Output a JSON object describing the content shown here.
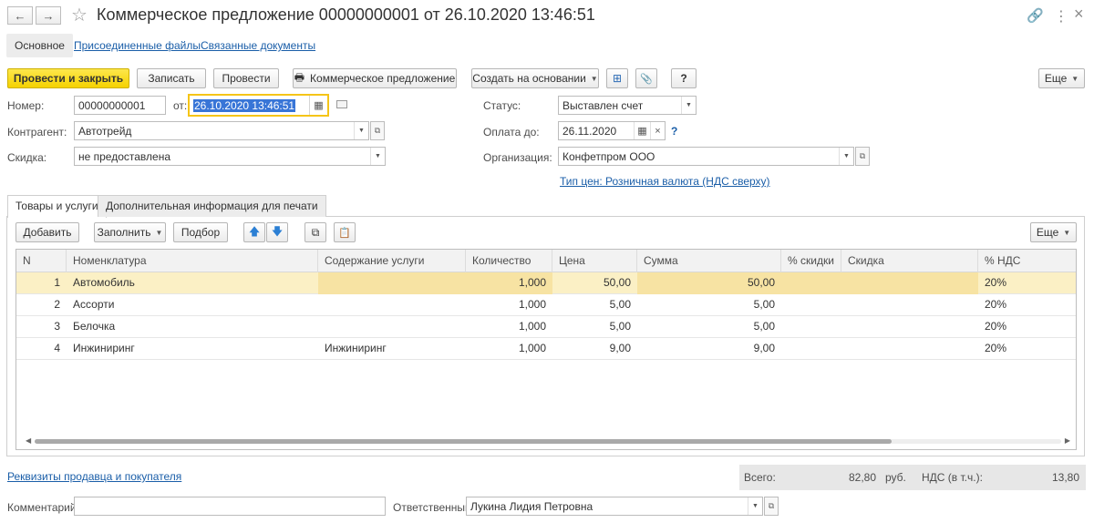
{
  "window": {
    "title": "Коммерческое предложение 00000000001 от 26.10.2020 13:46:51",
    "back_icon": "←",
    "forward_icon": "→",
    "star_icon": "☆",
    "link_icon": "🔗",
    "menu_icon": "⋮",
    "close_icon": "×"
  },
  "top_tabs": {
    "main": "Основное",
    "files": "Присоединенные файлы",
    "docs": "Связанные документы"
  },
  "toolbar": {
    "post_close": "Провести и закрыть",
    "save": "Записать",
    "post": "Провести",
    "print_icon": "🖶",
    "offer": "Коммерческое предложение",
    "create_based": "Создать на основании",
    "structure_icon": "⊞",
    "attach_icon": "📎",
    "help": "?",
    "more": "Еще"
  },
  "form": {
    "number_label": "Номер:",
    "number_value": "00000000001",
    "date_label": "от:",
    "date_value": "26.10.2020 13:46:51",
    "calendar_icon": "▦",
    "status_label": "Статус:",
    "status_value": "Выставлен счет",
    "contractor_label": "Контрагент:",
    "contractor_value": "Автотрейд",
    "pay_label": "Оплата до:",
    "pay_value": "26.11.2020",
    "clear_icon": "×",
    "pay_help": "?",
    "discount_label": "Скидка:",
    "discount_value": "не предоставлена",
    "org_label": "Организация:",
    "org_value": "Конфетпром ООО",
    "price_type_link": "Тип цен: Розничная валюта (НДС сверху)"
  },
  "inner_tabs": {
    "goods": "Товары и услуги",
    "extra": "Дополнительная информация для печати"
  },
  "table_toolbar": {
    "add": "Добавить",
    "fill": "Заполнить",
    "pick": "Подбор",
    "up_icon": "🡅",
    "down_icon": "🡇",
    "copy_icon": "⧉",
    "paste_icon": "📋",
    "more": "Еще"
  },
  "table": {
    "columns": [
      "N",
      "Номенклатура",
      "Содержание услуги",
      "Количество",
      "Цена",
      "Сумма",
      "% скидки",
      "Скидка",
      "% НДС"
    ],
    "rows": [
      {
        "n": "1",
        "name": "Автомобиль",
        "service": "",
        "qty": "1,000",
        "price": "50,00",
        "sum": "50,00",
        "disc_pct": "",
        "disc": "",
        "vat": "20%"
      },
      {
        "n": "2",
        "name": "Ассорти",
        "service": "",
        "qty": "1,000",
        "price": "5,00",
        "sum": "5,00",
        "disc_pct": "",
        "disc": "",
        "vat": "20%"
      },
      {
        "n": "3",
        "name": "Белочка",
        "service": "",
        "qty": "1,000",
        "price": "5,00",
        "sum": "5,00",
        "disc_pct": "",
        "disc": "",
        "vat": "20%"
      },
      {
        "n": "4",
        "name": "Инжиниринг",
        "service": "Инжиниринг",
        "qty": "1,000",
        "price": "9,00",
        "sum": "9,00",
        "disc_pct": "",
        "disc": "",
        "vat": "20%"
      }
    ]
  },
  "footer": {
    "requisites_link": "Реквизиты продавца и покупателя",
    "total_label": "Всего:",
    "total_value": "82,80",
    "currency": "руб.",
    "vat_label": "НДС (в т.ч.):",
    "vat_value": "13,80",
    "comment_label": "Комментарий:",
    "comment_value": "",
    "responsible_label": "Ответственный:",
    "responsible_value": "Лукина Лидия Петровна"
  }
}
